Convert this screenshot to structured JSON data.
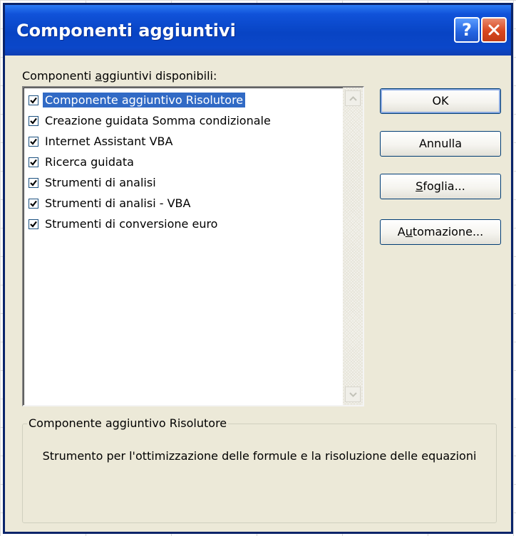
{
  "dialog": {
    "title": "Componenti aggiuntivi",
    "help_button": "?",
    "list_label_pre": "Componenti ",
    "list_label_accel": "a",
    "list_label_post": "ggiuntivi disponibili:",
    "addins": [
      {
        "label": "Componente aggiuntivo Risolutore",
        "checked": true,
        "selected": true
      },
      {
        "label": "Creazione guidata Somma condizionale",
        "checked": true,
        "selected": false
      },
      {
        "label": "Internet Assistant VBA",
        "checked": true,
        "selected": false
      },
      {
        "label": "Ricerca guidata",
        "checked": true,
        "selected": false
      },
      {
        "label": "Strumenti di analisi",
        "checked": true,
        "selected": false
      },
      {
        "label": "Strumenti di analisi - VBA",
        "checked": true,
        "selected": false
      },
      {
        "label": "Strumenti di conversione euro",
        "checked": true,
        "selected": false
      }
    ],
    "buttons": {
      "ok": "OK",
      "cancel": "Annulla",
      "browse_accel": "S",
      "browse_rest": "foglia...",
      "automation_pre": "A",
      "automation_accel": "u",
      "automation_rest": "tomazione..."
    },
    "description": {
      "title": "Componente aggiuntivo Risolutore",
      "text": "Strumento per l'ottimizzazione delle formule e la risoluzione delle equazioni"
    },
    "colors": {
      "titlebar": "#0844c4",
      "dialog_bg": "#ece9d8",
      "selection": "#316ac5",
      "close_button": "#d8471f"
    },
    "icons": [
      "help-icon",
      "close-icon",
      "checkbox-check-icon",
      "scroll-up-arrow-icon",
      "scroll-down-arrow-icon"
    ]
  }
}
